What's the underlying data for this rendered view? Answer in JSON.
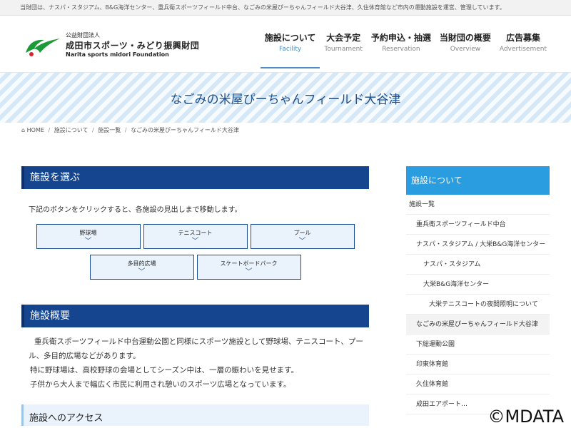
{
  "topbar": {
    "text": "当財団は、ナスパ・スタジアム、B&G海洋センター、重兵衛スポーツフィールド中台、なごみの米屋ぴーちゃんフィールド大谷津、久住体育館など市内の運動施設を運営、管理しています。"
  },
  "logo": {
    "small": "公益財団法人",
    "main": "成田市スポーツ・みどり振興財団",
    "en": "Narita sports midori Foundation",
    "colors": {
      "green": "#1c9a3a",
      "red": "#d0282e"
    }
  },
  "nav": [
    {
      "jp": "施設について",
      "en": "Facility",
      "active": true
    },
    {
      "jp": "大会予定",
      "en": "Tournament"
    },
    {
      "jp": "予約申込・抽選",
      "en": "Reservation"
    },
    {
      "jp": "当財団の概要",
      "en": "Overview"
    },
    {
      "jp": "広告募集",
      "en": "Advertisement"
    }
  ],
  "banner": {
    "title": "なごみの米屋ぴーちゃんフィールド大谷津"
  },
  "breadcrumb": {
    "home": "HOME",
    "items": [
      "施設について",
      "施設一覧",
      "なごみの米屋ぴーちゃんフィールド大谷津"
    ]
  },
  "select": {
    "title": "施設を選ぶ",
    "intro": "下記のボタンをクリックすると、各施設の見出しまで移動します。",
    "buttons": [
      "野球場",
      "テニスコート",
      "プール",
      "多目的広場",
      "スケートボードパーク"
    ]
  },
  "overview": {
    "title": "施設概要",
    "lines": [
      "重兵衛スポーツフィールド中台運動公園と同様にスポーツ施設として野球場、テニスコート、プー",
      "ル、多目的広場などがあります。",
      "特に野球場は、高校野球の会場としてシーズン中は、一層の賑わいを見せます。",
      "子供から大人まで幅広く市民に利用され憩いのスポーツ広場となっています。"
    ]
  },
  "access": {
    "title": "施設へのアクセス"
  },
  "sidebar": {
    "title": "施設について",
    "items": [
      "施設一覧",
      "重兵衛スポーツフィールド中台",
      "ナスパ・スタジアム / 大栄B&G海洋センター",
      "ナスパ・スタジアム",
      "大栄B&G海洋センター",
      "大栄テニスコートの夜間照明について",
      "なごみの米屋ぴーちゃんフィールド大谷津",
      "下総運動公園",
      "印東体育館",
      "久住体育館",
      "成田エアポート…"
    ]
  },
  "watermark": "©MDATA"
}
